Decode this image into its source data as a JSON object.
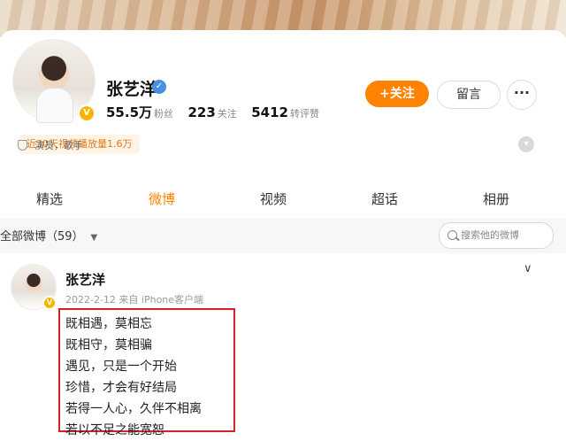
{
  "profile": {
    "name": "张艺洋",
    "stats": [
      {
        "value": "55.5万",
        "label": "粉丝"
      },
      {
        "value": "223",
        "label": "关注"
      },
      {
        "value": "5412",
        "label": "转评赞"
      }
    ],
    "follow_label": "+关注",
    "message_label": "留言",
    "more_label": "···",
    "video_plays": "近30天视频播放量1.6万",
    "tags": "演员，歌手"
  },
  "tabs": [
    {
      "label": "精选"
    },
    {
      "label": "微博",
      "active": true
    },
    {
      "label": "视频"
    },
    {
      "label": "超话"
    },
    {
      "label": "相册"
    }
  ],
  "filter": {
    "label": "全部微博（59）",
    "search_placeholder": "搜索他的微博"
  },
  "post": {
    "author": "张艺洋",
    "meta": "2022-2-12 来自 iPhone客户端",
    "lines": [
      "既相遇，莫相忘",
      "既相守，莫相骗",
      "遇见，只是一个开始",
      "珍惜，才会有好结局",
      "若得一人心，久伴不相离",
      "若以不足之能宽恕"
    ]
  },
  "colors": {
    "accent": "#ff8200",
    "highlight_border": "#d9202a",
    "verified_blue": "#4a90e2",
    "vip_gold": "#f7b500"
  }
}
